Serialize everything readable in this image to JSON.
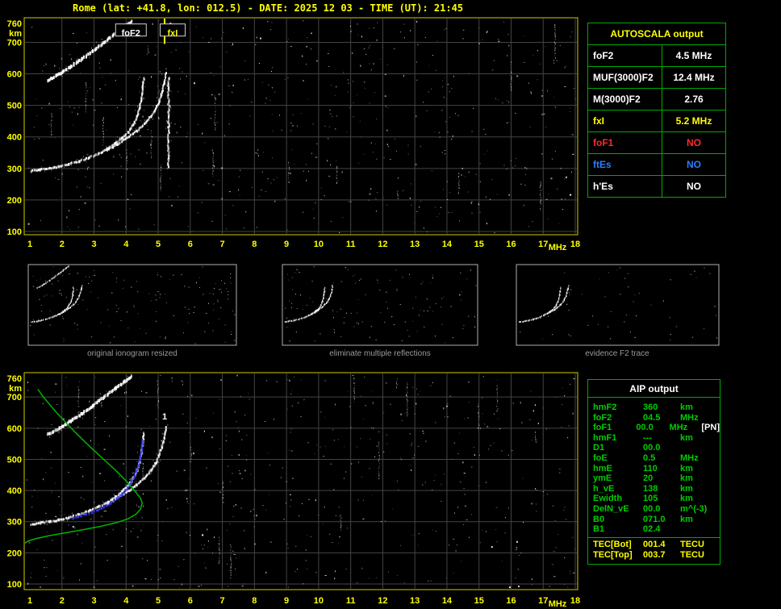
{
  "title": "Rome (lat: +41.8, lon: 012.5) - DATE: 2025 12 03 - TIME (UT): 21:45",
  "colors": {
    "axis": "#ffff00",
    "grid": "#444444",
    "plot_border": "#cccc00",
    "table_border": "#00aa00",
    "green_text": "#00cc00",
    "yellow": "#ffff00",
    "white": "#ffffff",
    "red": "#ff2a2a",
    "blue": "#2a7fff",
    "caption_gray": "#9a9a9a",
    "profile_green": "#00b400",
    "restored_blue": "#3535ee"
  },
  "autoscala": {
    "title": "AUTOSCALA output",
    "rows": [
      {
        "label": "foF2",
        "value": "4.5 MHz",
        "color": "#ffffff"
      },
      {
        "label": "MUF(3000)F2",
        "value": "12.4 MHz",
        "color": "#ffffff"
      },
      {
        "label": "M(3000)F2",
        "value": "2.76",
        "color": "#ffffff"
      },
      {
        "label": "fxI",
        "value": "5.2 MHz",
        "color": "#ffff00"
      },
      {
        "label": "foF1",
        "value": "NO",
        "color": "#ff2a2a"
      },
      {
        "label": "ftEs",
        "value": "NO",
        "color": "#2a7fff"
      },
      {
        "label": "h'Es",
        "value": "NO",
        "color": "#ffffff"
      }
    ]
  },
  "thumbnails": {
    "items": [
      {
        "caption": "original ionogram resized"
      },
      {
        "caption": "eliminate multiple reflections"
      },
      {
        "caption": "evidence F2 trace"
      }
    ]
  },
  "aip": {
    "title": "AIP output",
    "rows": [
      {
        "name": "hmF2",
        "value": "360",
        "unit": "km",
        "extra": ""
      },
      {
        "name": "foF2",
        "value": "04.5",
        "unit": "MHz",
        "extra": ""
      },
      {
        "name": "foF1",
        "value": "00.0",
        "unit": "MHz",
        "extra": "[PN]"
      },
      {
        "name": "hmF1",
        "value": "---",
        "unit": "km",
        "extra": ""
      },
      {
        "name": "D1",
        "value": "00.0",
        "unit": "",
        "extra": ""
      },
      {
        "name": "foE",
        "value": "0.5",
        "unit": "MHz",
        "extra": ""
      },
      {
        "name": "hmE",
        "value": "110",
        "unit": "km",
        "extra": ""
      },
      {
        "name": "ymE",
        "value": "20",
        "unit": "km",
        "extra": ""
      },
      {
        "name": "h_vE",
        "value": "138",
        "unit": "km",
        "extra": ""
      },
      {
        "name": "Ewidth",
        "value": "105",
        "unit": "km",
        "extra": ""
      },
      {
        "name": "DelN_vE",
        "value": "00.0",
        "unit": "m^(-3)",
        "extra": ""
      },
      {
        "name": "B0",
        "value": "071.0",
        "unit": "km",
        "extra": ""
      },
      {
        "name": "B1",
        "value": "02.4",
        "unit": "",
        "extra": ""
      }
    ],
    "tec_rows": [
      {
        "name": "TEC[Bot]",
        "value": "001.4",
        "unit": "TECU"
      },
      {
        "name": "TEC[Top]",
        "value": "003.7",
        "unit": "TECU"
      }
    ]
  },
  "chart_data": [
    {
      "id": "ionogram_autoscaled",
      "type": "scatter",
      "title": "",
      "xlabel": "MHz",
      "ylabel": "km",
      "xlim": [
        1,
        18
      ],
      "ylim": [
        100,
        760
      ],
      "x_ticks": [
        1,
        2,
        3,
        4,
        5,
        6,
        7,
        8,
        9,
        10,
        11,
        12,
        13,
        14,
        15,
        16,
        17,
        18
      ],
      "y_ticks": [
        760,
        700,
        600,
        500,
        400,
        300,
        200,
        100
      ],
      "grid": true,
      "series": [
        {
          "name": "F2 trace o-mode",
          "color": "#ffffff",
          "style": "dots",
          "weight": 1,
          "points": [
            [
              1.0,
              295
            ],
            [
              1.3,
              299
            ],
            [
              1.6,
              304
            ],
            [
              1.9,
              310
            ],
            [
              2.2,
              317
            ],
            [
              2.5,
              326
            ],
            [
              2.8,
              337
            ],
            [
              3.1,
              350
            ],
            [
              3.4,
              366
            ],
            [
              3.65,
              383
            ],
            [
              3.85,
              400
            ],
            [
              4.05,
              420
            ],
            [
              4.2,
              443
            ],
            [
              4.32,
              468
            ],
            [
              4.4,
              495
            ],
            [
              4.46,
              525
            ],
            [
              4.5,
              558
            ],
            [
              4.53,
              590
            ]
          ]
        },
        {
          "name": "F2 trace x-mode",
          "color": "#ffffff",
          "style": "dots",
          "weight": 1,
          "points": [
            [
              3.4,
              362
            ],
            [
              3.7,
              380
            ],
            [
              4.0,
              399
            ],
            [
              4.3,
              421
            ],
            [
              4.55,
              444
            ],
            [
              4.75,
              468
            ],
            [
              4.9,
              492
            ],
            [
              5.0,
              516
            ],
            [
              5.1,
              545
            ],
            [
              5.17,
              575
            ],
            [
              5.21,
              605
            ]
          ]
        },
        {
          "name": "second-order echo",
          "color": "#ffffff",
          "style": "dots",
          "weight": 2,
          "points": [
            [
              1.55,
              585
            ],
            [
              1.9,
              605
            ],
            [
              2.25,
              628
            ],
            [
              2.6,
              652
            ],
            [
              2.95,
              678
            ],
            [
              3.3,
              705
            ],
            [
              3.65,
              733
            ],
            [
              3.95,
              755
            ],
            [
              4.15,
              772
            ]
          ]
        },
        {
          "name": "vertical spread echo",
          "color": "#ffffff",
          "style": "dots",
          "weight": 1,
          "points": [
            [
              5.3,
              310
            ],
            [
              5.3,
              590
            ]
          ]
        }
      ],
      "annotations": [
        {
          "text": "foF2",
          "mhz": 4.15,
          "km": 730,
          "color": "#ffffff",
          "box": true
        },
        {
          "text": "fxI",
          "mhz": 5.45,
          "km": 730,
          "color": "#ffff00",
          "box": true
        }
      ],
      "markers": [
        {
          "type": "vline",
          "mhz": 5.2,
          "km_from": 778,
          "km_to": 695,
          "color": "#ffff00"
        }
      ]
    },
    {
      "id": "ionogram_inversion",
      "type": "scatter",
      "title": "",
      "xlabel": "MHz",
      "ylabel": "km",
      "xlim": [
        1,
        18
      ],
      "ylim": [
        100,
        760
      ],
      "x_ticks": [
        1,
        2,
        3,
        4,
        5,
        6,
        7,
        8,
        9,
        10,
        11,
        12,
        13,
        14,
        15,
        16,
        17,
        18
      ],
      "y_ticks": [
        760,
        700,
        600,
        500,
        400,
        300,
        200,
        100
      ],
      "grid": true,
      "series": [
        {
          "name": "F2 trace o-mode",
          "color": "#ffffff",
          "style": "dots",
          "weight": 1,
          "points": [
            [
              1.0,
              295
            ],
            [
              1.3,
              299
            ],
            [
              1.6,
              304
            ],
            [
              1.9,
              310
            ],
            [
              2.2,
              317
            ],
            [
              2.5,
              326
            ],
            [
              2.8,
              337
            ],
            [
              3.1,
              350
            ],
            [
              3.4,
              366
            ],
            [
              3.65,
              383
            ],
            [
              3.85,
              400
            ],
            [
              4.05,
              420
            ],
            [
              4.2,
              443
            ],
            [
              4.32,
              468
            ],
            [
              4.4,
              495
            ],
            [
              4.46,
              525
            ],
            [
              4.5,
              558
            ],
            [
              4.53,
              590
            ]
          ]
        },
        {
          "name": "F2 trace x-mode",
          "color": "#ffffff",
          "style": "dots",
          "weight": 1,
          "points": [
            [
              3.4,
              362
            ],
            [
              3.7,
              380
            ],
            [
              4.0,
              399
            ],
            [
              4.3,
              421
            ],
            [
              4.55,
              444
            ],
            [
              4.75,
              468
            ],
            [
              4.9,
              492
            ],
            [
              5.0,
              516
            ],
            [
              5.1,
              545
            ],
            [
              5.17,
              575
            ],
            [
              5.21,
              605
            ]
          ]
        },
        {
          "name": "second-order echo",
          "color": "#ffffff",
          "style": "dots",
          "weight": 2,
          "points": [
            [
              1.55,
              585
            ],
            [
              1.9,
              605
            ],
            [
              2.25,
              628
            ],
            [
              2.6,
              652
            ],
            [
              2.95,
              678
            ],
            [
              3.3,
              705
            ],
            [
              3.65,
              733
            ],
            [
              3.95,
              755
            ],
            [
              4.15,
              772
            ]
          ]
        },
        {
          "name": "restored F2 trace",
          "color": "#3535ee",
          "style": "dots",
          "weight": 1,
          "points": [
            [
              2.3,
              315
            ],
            [
              2.6,
              323
            ],
            [
              2.9,
              333
            ],
            [
              3.2,
              347
            ],
            [
              3.5,
              364
            ],
            [
              3.75,
              383
            ],
            [
              3.95,
              403
            ],
            [
              4.12,
              427
            ],
            [
              4.25,
              452
            ],
            [
              4.35,
              480
            ],
            [
              4.42,
              510
            ],
            [
              4.47,
              540
            ],
            [
              4.5,
              565
            ]
          ]
        },
        {
          "name": "electron density profile",
          "color": "#00b400",
          "style": "line",
          "points": [
            [
              1.25,
              725
            ],
            [
              1.4,
              703
            ],
            [
              1.6,
              678
            ],
            [
              1.85,
              648
            ],
            [
              2.15,
              615
            ],
            [
              2.5,
              578
            ],
            [
              2.9,
              538
            ],
            [
              3.3,
              500
            ],
            [
              3.7,
              462
            ],
            [
              4.05,
              425
            ],
            [
              4.3,
              395
            ],
            [
              4.45,
              375
            ],
            [
              4.5,
              360
            ],
            [
              4.45,
              340
            ],
            [
              4.3,
              323
            ],
            [
              4.05,
              309
            ],
            [
              3.7,
              297
            ],
            [
              3.25,
              286
            ],
            [
              2.7,
              275
            ],
            [
              2.1,
              264
            ],
            [
              1.6,
              255
            ],
            [
              1.2,
              246
            ],
            [
              0.95,
              238
            ],
            [
              0.8,
              228
            ]
          ]
        }
      ],
      "annotations": [
        {
          "text": "1",
          "mhz": 5.2,
          "km": 638,
          "color": "#ffffff",
          "box": false
        }
      ],
      "markers": []
    }
  ]
}
